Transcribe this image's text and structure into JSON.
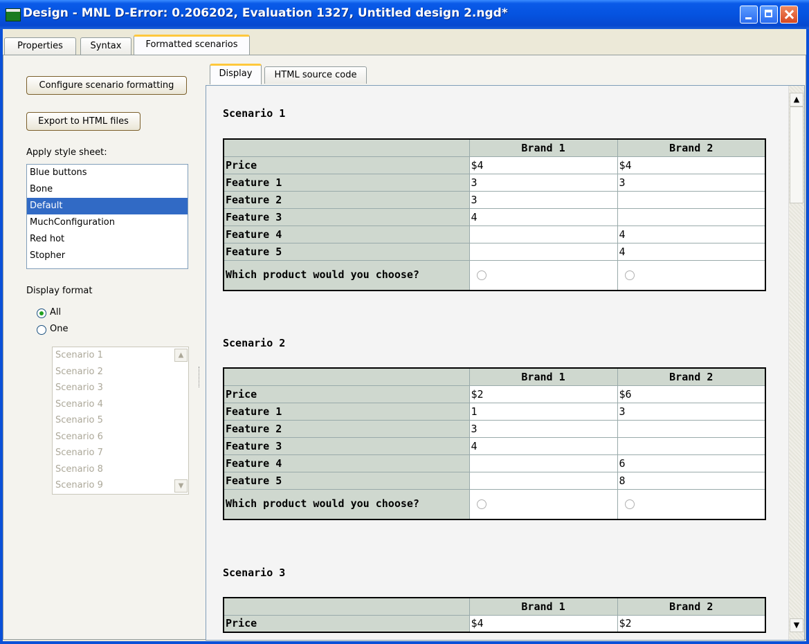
{
  "window": {
    "title": "Design  -  MNL D-Error: 0.206202,  Evaluation 1327,  Untitled design 2.ngd*"
  },
  "tabs": [
    {
      "label": "Properties"
    },
    {
      "label": "Syntax"
    },
    {
      "label": "Formatted scenarios"
    }
  ],
  "left": {
    "configure_button": "Configure scenario formatting",
    "export_button": "Export to HTML files",
    "stylesheet_label": "Apply style sheet:",
    "stylesheets": [
      "Blue buttons",
      "Bone",
      "Default",
      "MuchConfiguration",
      "Red hot",
      "Stopher"
    ],
    "selected_stylesheet": "Default",
    "display_format_label": "Display format",
    "radio_all": "All",
    "radio_one": "One",
    "scenario_list": [
      "Scenario 1",
      "Scenario 2",
      "Scenario 3",
      "Scenario 4",
      "Scenario 5",
      "Scenario 6",
      "Scenario 7",
      "Scenario 8",
      "Scenario 9"
    ]
  },
  "inner_tabs": [
    {
      "label": "Display"
    },
    {
      "label": "HTML source code"
    }
  ],
  "scenarios": [
    {
      "title": "Scenario 1",
      "headers": [
        "Brand 1",
        "Brand 2"
      ],
      "rows": [
        [
          "Price",
          "$4",
          "$4"
        ],
        [
          "Feature 1",
          "3",
          "3"
        ],
        [
          "Feature 2",
          "3",
          ""
        ],
        [
          "Feature 3",
          "4",
          ""
        ],
        [
          "Feature 4",
          "",
          "4"
        ],
        [
          "Feature 5",
          "",
          "4"
        ]
      ],
      "question": "Which product would you choose?"
    },
    {
      "title": "Scenario 2",
      "headers": [
        "Brand 1",
        "Brand 2"
      ],
      "rows": [
        [
          "Price",
          "$2",
          "$6"
        ],
        [
          "Feature 1",
          "1",
          "3"
        ],
        [
          "Feature 2",
          "3",
          ""
        ],
        [
          "Feature 3",
          "4",
          ""
        ],
        [
          "Feature 4",
          "",
          "6"
        ],
        [
          "Feature 5",
          "",
          "8"
        ]
      ],
      "question": "Which product would you choose?"
    },
    {
      "title": "Scenario 3",
      "headers": [
        "Brand 1",
        "Brand 2"
      ],
      "rows": [
        [
          "Price",
          "$4",
          "$2"
        ]
      ]
    }
  ]
}
